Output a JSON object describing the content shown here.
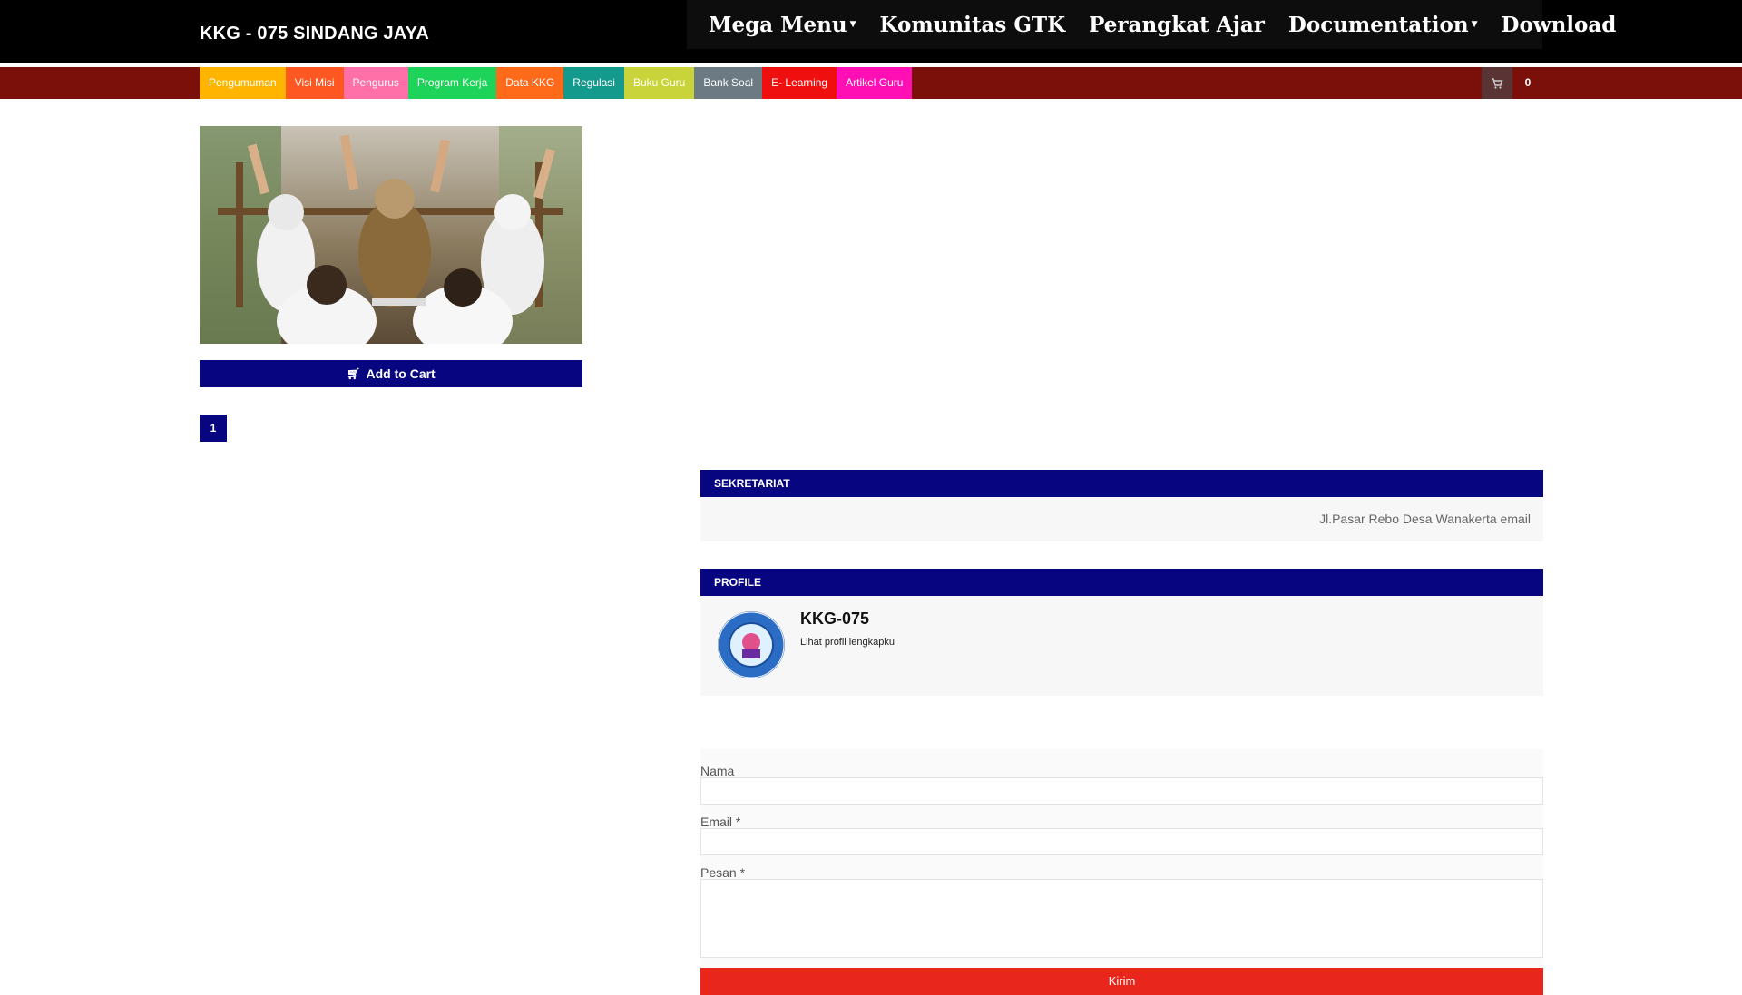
{
  "header": {
    "site_title": "KKG - 075 SINDANG JAYA",
    "nav": [
      {
        "label": "Mega Menu",
        "has_dropdown": true
      },
      {
        "label": "Komunitas GTK",
        "has_dropdown": false
      },
      {
        "label": "Perangkat Ajar",
        "has_dropdown": false
      },
      {
        "label": "Documentation",
        "has_dropdown": true
      },
      {
        "label": "Download",
        "has_dropdown": false
      }
    ]
  },
  "categories": [
    {
      "label": "Pengumuman",
      "color": "#ffb400"
    },
    {
      "label": "Visi Misi",
      "color": "#ff5722"
    },
    {
      "label": "Pengurus",
      "color": "#ff6fa8"
    },
    {
      "label": "Program Kerja",
      "color": "#1dd35a"
    },
    {
      "label": "Data KKG",
      "color": "#ff6a1a"
    },
    {
      "label": "Regulasi",
      "color": "#139a8c"
    },
    {
      "label": "Buku Guru",
      "color": "#c8d43a"
    },
    {
      "label": "Bank Soal",
      "color": "#6b7a83"
    },
    {
      "label": "E- Learning",
      "color": "#f00f0f"
    },
    {
      "label": "Artikel Guru",
      "color": "#ff0fb4"
    }
  ],
  "cart": {
    "icon": "cart-icon",
    "count": "0"
  },
  "product": {
    "image_icon": "photo-classroom",
    "add_to_cart_label": "Add to Cart",
    "add_to_cart_icon": "cart-icon"
  },
  "pagination": {
    "current_page": "1"
  },
  "sidebar": {
    "sekretariat": {
      "heading": "SEKRETARIAT",
      "text": "Jl.Pasar Rebo Desa Wanakerta email"
    },
    "profile": {
      "heading": "PROFILE",
      "name": "KKG-075",
      "link_text": "Lihat profil lengkapku",
      "logo_icon": "kkg-logo"
    }
  },
  "contact_form": {
    "name_label": "Nama",
    "name_value": "",
    "email_label": "Email",
    "email_value": "",
    "message_label": "Pesan",
    "message_value": "",
    "required_mark": "*",
    "submit_label": "Kirim"
  },
  "colors": {
    "header_bg": "#000000",
    "category_bar_bg": "#7b0f0a",
    "primary_navy": "#080580",
    "submit_red": "#e8261b"
  }
}
